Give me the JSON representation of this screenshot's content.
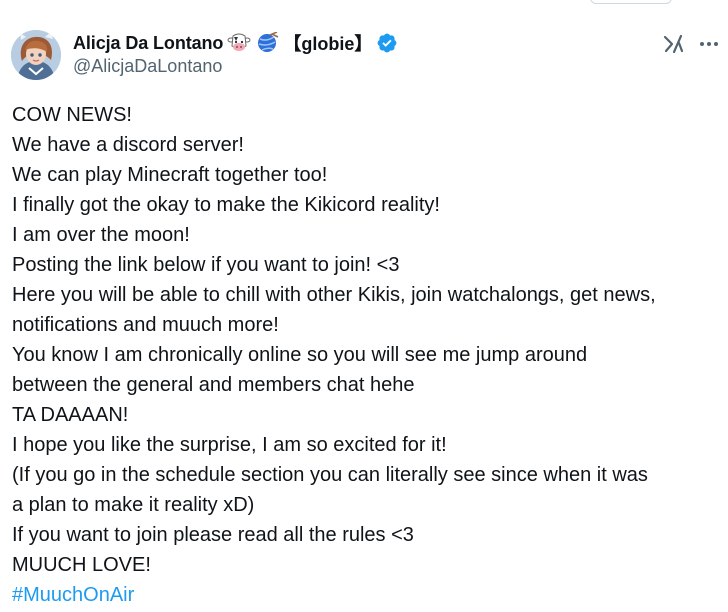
{
  "tweet": {
    "author": {
      "display_name": "Alicja Da Lontano",
      "name_suffix": "【globie】",
      "handle": "@AlicjaDaLontano",
      "emoji_1": "cow-face-icon",
      "emoji_2": "yarn-icon",
      "verified": "verified-badge-icon",
      "avatar": "avatar"
    },
    "actions": {
      "grok": "grok-icon",
      "more": "more-options-icon"
    },
    "body_lines": [
      "COW NEWS!",
      "We have a discord server!",
      "We can play Minecraft together too!",
      "I finally got the okay to make the Kikicord reality!",
      "I am over the moon!",
      "Posting the link below if you want to join! <3",
      "Here you will be able to chill with other Kikis, join watchalongs, get news,",
      "notifications and muuch more!",
      "You know I am chronically online so you will see me jump around",
      "between the general and members chat hehe",
      "TA DAAAAN!",
      "I hope you like the surprise, I am so excited for it!",
      "(If you go in the schedule section you can literally see since when it was",
      "a plan to make it reality xD)",
      "If you want to join please read all the rules <3",
      "MUUCH LOVE!"
    ],
    "hashtag": "#MuuchOnAir"
  },
  "colors": {
    "text": "#0f1419",
    "secondary": "#536471",
    "link": "#1d9bf0",
    "verified": "#1d9bf0"
  }
}
